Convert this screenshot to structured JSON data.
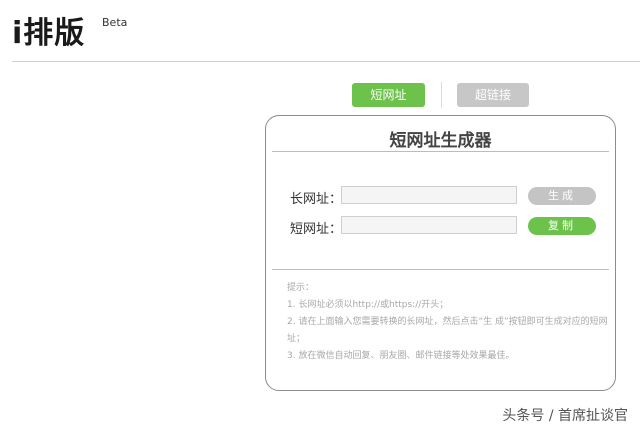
{
  "header": {
    "logo": "i排版",
    "beta": "Beta"
  },
  "tabs": [
    {
      "label": "短网址",
      "active": true
    },
    {
      "label": "超链接",
      "active": false
    }
  ],
  "panel": {
    "title": "短网址生成器",
    "long_url": {
      "label": "长网址：",
      "value": "",
      "button": "生成"
    },
    "short_url": {
      "label": "短网址：",
      "value": "",
      "button": "复制"
    }
  },
  "tips": {
    "heading": "提示：",
    "items": [
      "1. 长网址必须以http://或https://开头；",
      "2. 请在上面输入您需要转换的长网址，然后点击“生 成”按钮即可生成对应的短网址；",
      "3. 放在微信自动回复、朋友圈、邮件链接等处效果最佳。"
    ]
  },
  "watermark": "头条号 / 首席扯谈官",
  "colors": {
    "accent": "#6cc24a",
    "inactive": "#c7c7c7",
    "border": "#8c8c8c"
  }
}
